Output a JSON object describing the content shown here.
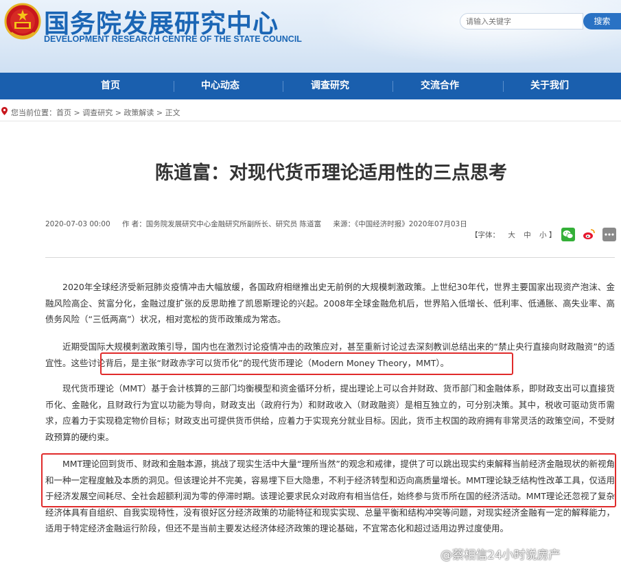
{
  "header": {
    "title": "国务院发展研究中心",
    "subtitle": "DEVELOPMENT RESEARCH CENTRE OF THE STATE COUNCIL",
    "search_placeholder": "请输入关键字",
    "search_button": "搜索",
    "brand_color": "#1b66b5"
  },
  "nav": {
    "items": [
      {
        "label": "首页"
      },
      {
        "label": "中心动态"
      },
      {
        "label": "调查研究"
      },
      {
        "label": "交流合作"
      },
      {
        "label": "关于我们"
      }
    ],
    "bg_color": "#1a5fae"
  },
  "breadcrumb": {
    "text": "您当前位置：首页  >  调查研究  >  政策解读  >  正文"
  },
  "article": {
    "title": "陈道富：对现代货币理论适用性的三点思考",
    "date": "2020-07-03 00:00",
    "author": "作 者：国务院发展研究中心金融研究所副所长、研究员 陈道富",
    "source": "来源：《中国经济时报》2020年07月03日",
    "font_size": {
      "label": "【字体：",
      "large": "大",
      "medium": "中",
      "small": "小",
      "close": "】"
    },
    "share_icons": [
      "wechat-icon",
      "weibo-icon",
      "more-icon"
    ],
    "paragraphs": [
      "2020年全球经济受新冠肺炎疫情冲击大幅放缓，各国政府相继推出史无前例的大规模刺激政策。上世纪30年代，世界主要国家出现资产泡沫、金融风险高企、贫富分化，金融过度扩张的反思助推了凯恩斯理论的兴起。2008年全球金融危机后，世界陷入低增长、低利率、低通胀、高失业率、高债务风险（“三低两高”）状况，相对宽松的货币政策成为常态。",
      "近期受国际大规模刺激政策引导，国内也在激烈讨论疫情冲击的政策应对，甚至重新讨论过去深刻教训总结出来的“禁止央行直接向财政融资”的适宜性。这些讨论背后，是主张“财政赤字可以货币化”的现代货币理论（Modern Money Theory，MMT）。",
      "现代货币理论（MMT）基于会计核算的三部门均衡模型和资金循环分析，提出理论上可以合并财政、货币部门和金融体系，即财政支出可以直接货币化、金融化，且财政行为宜以功能为导向，财政支出（政府行为）和财政收入（财政融资）是相互独立的，可分别决策。其中，税收可驱动货币需求，应着力于实现稳定物价目标；财政支出可提供货币供给，应着力于实现充分就业目标。因此，货币主权国的政府拥有非常灵活的政策空间，不受财政预算的硬约束。",
      "MMT理论回到货币、财政和金融本源，挑战了现实生活中大量“理所当然”的观念和戒律，提供了可以跳出现实约束解释当前经济金融现状的新视角和一种一定程度触及本质的洞见。但该理论并不完美，容易埋下巨大隐患，不利于经济转型和迈向高质量增长。MMT理论缺乏结构性改革工具，仅适用于经济发展空间耗尽、全社会超额利润为零的停滞时期。该理论要求民众对政府有相当信任，始终参与货币所在国的经济活动。MMT理论还忽视了复杂经济体具有自组织、自我实现特性，没有很好区分经济政策的功能特征和现实实现、总量平衡和结构冲突等问题，对现实经济金融有一定的解释能力，适用于特定经济金融运行阶段，但还不是当前主要发达经济体经济政策的理论基础，不宜常态化和超过适用边界过度使用。"
    ],
    "highlight_color": "#e02a2a"
  },
  "watermark": {
    "text": "@蔡相信24小时说房产"
  }
}
